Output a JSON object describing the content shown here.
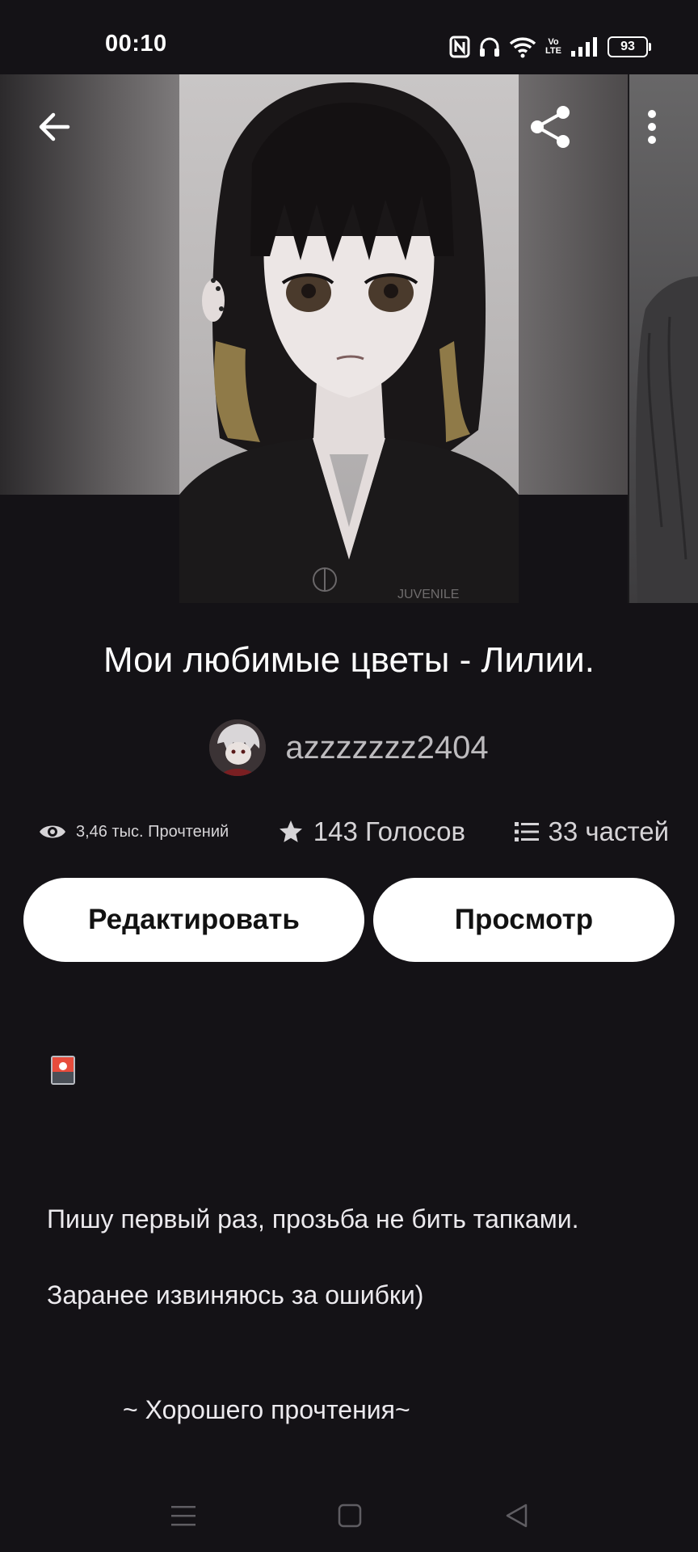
{
  "status_bar": {
    "time": "00:10",
    "battery": "93",
    "volte_label": "Vo LTE"
  },
  "story": {
    "title": "Мои любимые цветы - Лилии.",
    "author": "azzzzzzz2404",
    "cover_watermark": "JUVENILE"
  },
  "stats": {
    "reads": "3,46 тыс. Прочтений",
    "votes": "143 Голосов",
    "parts": "33 частей"
  },
  "actions": {
    "edit_label": "Редактировать",
    "preview_label": "Просмотр"
  },
  "description": {
    "line1": "Пишу первый раз, прозьба не бить тапками.",
    "line2": "Заранее извиняюсь за ошибки)",
    "line3": "~ Хорошего прочтения~"
  },
  "colors": {
    "background": "#141216",
    "button_bg": "#ffffff",
    "button_text": "#121212",
    "muted_text": "#bdbbbe"
  },
  "icons": [
    "back-arrow-icon",
    "share-icon",
    "more-vertical-icon",
    "eye-icon",
    "star-icon",
    "list-icon",
    "image-placeholder-icon",
    "nfc-icon",
    "headphones-icon",
    "wifi-icon",
    "signal-icon",
    "battery-icon",
    "menu-nav-icon",
    "home-nav-icon",
    "back-nav-icon"
  ]
}
